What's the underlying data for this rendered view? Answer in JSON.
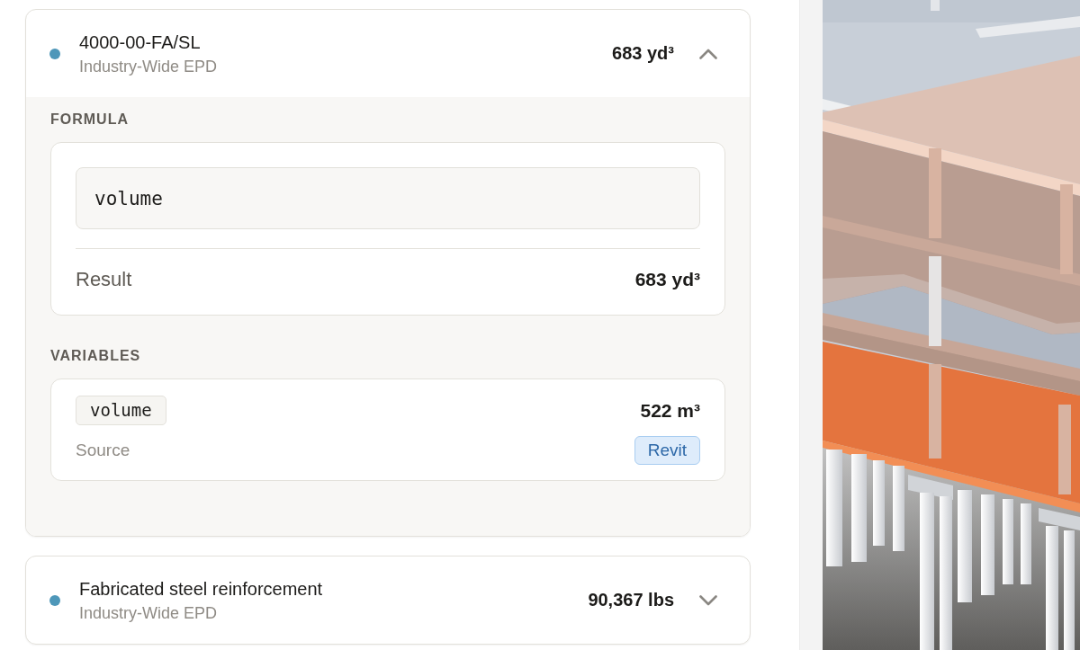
{
  "materials": [
    {
      "name": "4000-00-FA/SL",
      "source": "Industry-Wide EPD",
      "quantity": "683 yd³",
      "color": "#4e97b9",
      "expanded": true,
      "details": {
        "formula_heading": "FORMULA",
        "formula": "volume",
        "result_label": "Result",
        "result": "683 yd³",
        "variables_heading": "VARIABLES",
        "variables": [
          {
            "name": "volume",
            "value": "522 m³",
            "source_label": "Source",
            "source": "Revit"
          }
        ]
      }
    },
    {
      "name": "Fabricated steel reinforcement",
      "source": "Industry-Wide EPD",
      "quantity": "90,367 lbs",
      "color": "#4e97b9",
      "expanded": false
    }
  ]
}
